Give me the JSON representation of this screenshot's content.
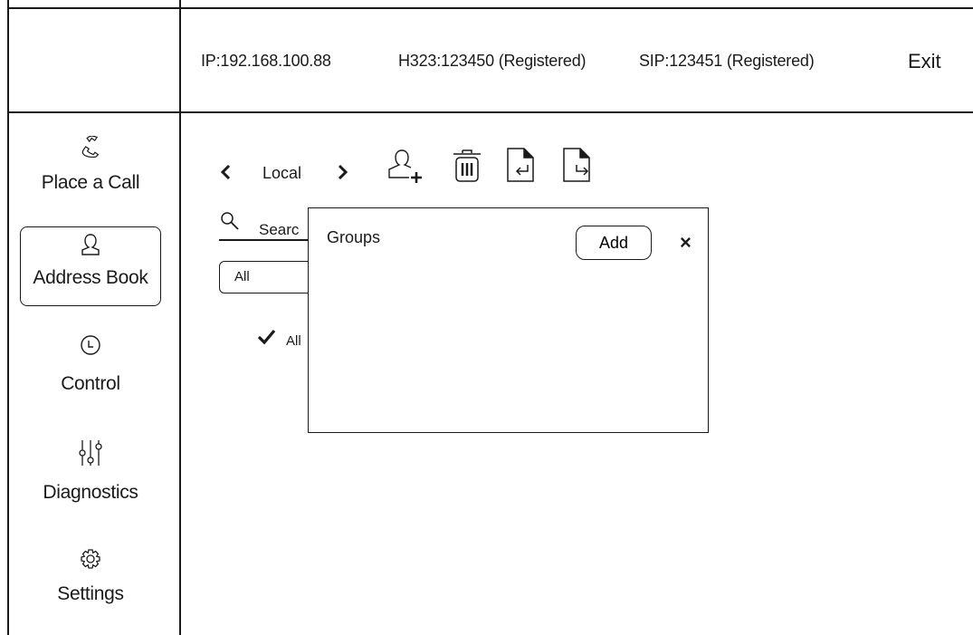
{
  "status_bar": {
    "ip": "IP:192.168.100.88",
    "h323": "H323:123450 (Registered)",
    "sip": "SIP:123451 (Registered)",
    "exit_label": "Exit"
  },
  "sidebar": {
    "items": [
      {
        "label": "Place a Call",
        "icon": "phone-icon"
      },
      {
        "label": "Address Book",
        "icon": "person-icon",
        "active": true
      },
      {
        "label": "Control",
        "icon": "clock-icon"
      },
      {
        "label": "Diagnostics",
        "icon": "sliders-icon"
      },
      {
        "label": "Settings",
        "icon": "gear-icon"
      }
    ]
  },
  "toolbar": {
    "prev_icon": "chevron-left-icon",
    "location_label": "Local",
    "next_icon": "chevron-right-icon",
    "actions": [
      "add-contact-icon",
      "trash-icon",
      "import-icon",
      "export-icon"
    ]
  },
  "search": {
    "placeholder": "Search",
    "visible_text": "Searc"
  },
  "group_filter": {
    "selected": "All"
  },
  "group_list": {
    "items": [
      {
        "label": "All",
        "checked": true
      }
    ]
  },
  "groups_dialog": {
    "title": "Groups",
    "add_label": "Add",
    "close_label": "×"
  }
}
